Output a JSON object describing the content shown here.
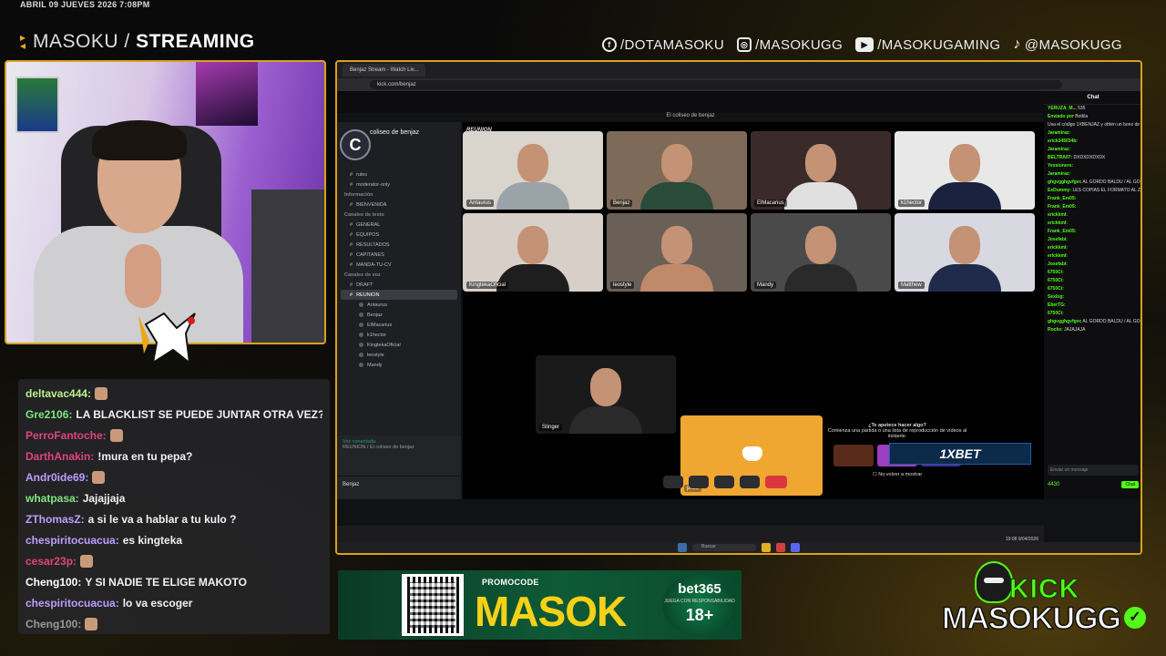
{
  "overlay": {
    "datetime": "ABRIL 09 JUEVES 2026 7:08PM",
    "brand_light": "MASOKU /",
    "brand_bold": "STREAMING",
    "socials": [
      {
        "icon": "facebook-icon",
        "label": "/DOTAMASOKU"
      },
      {
        "icon": "instagram-icon",
        "label": "/MASOKUGG"
      },
      {
        "icon": "youtube-icon",
        "label": "/MASOKUGAMING"
      },
      {
        "icon": "tiktok-icon",
        "label": "@MASOKUGG"
      }
    ],
    "accent": "#d9a21b"
  },
  "chat": {
    "messages": [
      {
        "user": "deltavac444:",
        "color": "#b9f18a",
        "text": "",
        "emote": true
      },
      {
        "user": "Gre2106:",
        "color": "#7ee87e",
        "text": "LA BLACKLIST SE PUEDE JUNTAR OTRA VEZ?",
        "emote": false
      },
      {
        "user": "PerroFantoche:",
        "color": "#e0457b",
        "text": "",
        "emote": true
      },
      {
        "user": "DarthAnakin:",
        "color": "#e0457b",
        "text": "!mura en tu pepa?",
        "emote": false
      },
      {
        "user": "Andr0ide69:",
        "color": "#b9a0ff",
        "text": "",
        "emote": true
      },
      {
        "user": "whatpasa:",
        "color": "#7ee87e",
        "text": "Jajajjaja",
        "emote": false
      },
      {
        "user": "ZThomasZ:",
        "color": "#b9a0ff",
        "text": "a si le va a hablar a tu kulo ?",
        "emote": false
      },
      {
        "user": "chespiritocuacua:",
        "color": "#b9a0ff",
        "text": "es kingteka",
        "emote": false
      },
      {
        "user": "cesar23p:",
        "color": "#e0457b",
        "text": "",
        "emote": true
      },
      {
        "user": "Cheng100:",
        "color": "#ffffff",
        "text": "Y SI NADIE TE ELIGE MAKOTO",
        "emote": false
      },
      {
        "user": "chespiritocuacua:",
        "color": "#b9a0ff",
        "text": "lo va escoger",
        "emote": false
      },
      {
        "user": "Cheng100:",
        "color": "#9a9a9a",
        "text": "",
        "emote": true
      }
    ]
  },
  "browser": {
    "tab": "Benjaz Stream - Watch Liv...",
    "url": "kick.com/benjaz"
  },
  "discord": {
    "window_title": "El coliseo de benjaz",
    "server_name": "coliseo de benjaz",
    "sidebar": [
      {
        "label": "rules",
        "type": "ch"
      },
      {
        "label": "moderator-only",
        "type": "ch"
      },
      {
        "label": "Información",
        "type": "head"
      },
      {
        "label": "BIENVENIDA",
        "type": "ch"
      },
      {
        "label": "Canales de texto",
        "type": "head"
      },
      {
        "label": "GENERAL",
        "type": "ch"
      },
      {
        "label": "EQUIPOS",
        "type": "ch"
      },
      {
        "label": "RESULTADOS",
        "type": "ch"
      },
      {
        "label": "CAPITANES",
        "type": "ch"
      },
      {
        "label": "MANDA-TU-CV",
        "type": "ch"
      },
      {
        "label": "Canales de voz",
        "type": "head"
      },
      {
        "label": "DRAFT",
        "type": "ch"
      },
      {
        "label": "REUNION",
        "type": "sel"
      },
      {
        "label": "Antaurus",
        "type": "user"
      },
      {
        "label": "Benjaz",
        "type": "user"
      },
      {
        "label": "ElMacarius",
        "type": "user"
      },
      {
        "label": "k1hector",
        "type": "user"
      },
      {
        "label": "KingtekaOficial",
        "type": "user"
      },
      {
        "label": "leostyle",
        "type": "user"
      },
      {
        "label": "Mandy",
        "type": "user"
      }
    ],
    "voice_status": "Voz conectada",
    "voice_channel": "REUNION / El coliseo de benjaz",
    "user_name": "Benjaz",
    "stage_title": "REUNION",
    "tiles": [
      {
        "name": "Antaurus",
        "bg": "#d9d4cc",
        "shirt": "#9aa3a8"
      },
      {
        "name": "Benjaz",
        "bg": "#7d6a58",
        "shirt": "#2a4a3a"
      },
      {
        "name": "ElMacarius",
        "bg": "#3a2a2a",
        "shirt": "#e0e0e0"
      },
      {
        "name": "k1hector",
        "bg": "#e8e8e8",
        "shirt": "#1a2240"
      },
      {
        "name": "KingtekaOficial",
        "bg": "#d8d0c8",
        "shirt": "#1e1e1e"
      },
      {
        "name": "leostyle",
        "bg": "#6a6058",
        "shirt": "#c08a6a"
      },
      {
        "name": "Mandy",
        "bg": "#4a4a4a",
        "shirt": "#2a2a2a"
      },
      {
        "name": "Matthew",
        "bg": "#d8d8e0",
        "shirt": "#202a4a"
      },
      {
        "name": "Stinger",
        "bg": "#1a1a1a",
        "shirt": "#2a2a2a"
      }
    ],
    "pkza_label": "pkza",
    "activity_title": "¿Te apetece hacer algo?",
    "activity_sub": "Comienza una partida o una lista de reproducción de vídeos al instante.",
    "activity_checkbox": "No volver a mostrar",
    "sponsor": "1XBET"
  },
  "kick_chat": {
    "title": "Chat",
    "lines": [
      {
        "n": "YERUZA_M...",
        "t": "535"
      },
      {
        "n": "Enviado por",
        "t": "Botkla"
      },
      {
        "n": "",
        "t": "Usa el código 1XBENJAZ y obtén un bono de hasta s/1100 con tu primer..."
      },
      {
        "n": "Jaramiraz:",
        "t": ""
      },
      {
        "n": "erick345034b:",
        "t": ""
      },
      {
        "n": "Jaramiraz:",
        "t": ""
      },
      {
        "n": "BELTRA07:",
        "t": "DXDXDXDXDX"
      },
      {
        "n": "Yessioners:",
        "t": ""
      },
      {
        "n": "Jaramiraz:",
        "t": ""
      },
      {
        "n": "ghgvgghgvfgvc",
        "t": "AL GORDO BALDU / AL GORDO BALDU / DV"
      },
      {
        "n": "EsDummy:",
        "t": "LES COPIAS EL FORMATO AL ZZZ"
      },
      {
        "n": "Frank_Em05:",
        "t": ""
      },
      {
        "n": "Frank_Em05:",
        "t": ""
      },
      {
        "n": "erickkml:",
        "t": ""
      },
      {
        "n": "erickkml:",
        "t": ""
      },
      {
        "n": "Frank_Em05:",
        "t": ""
      },
      {
        "n": "Josefabi:",
        "t": ""
      },
      {
        "n": "erickkml:",
        "t": ""
      },
      {
        "n": "erickkml:",
        "t": ""
      },
      {
        "n": "Josefabi:",
        "t": ""
      },
      {
        "n": "6750Ci:",
        "t": ""
      },
      {
        "n": "6750Ci:",
        "t": ""
      },
      {
        "n": "6750Ci:",
        "t": ""
      },
      {
        "n": "Sexlog:",
        "t": ""
      },
      {
        "n": "EberTG:",
        "t": ""
      },
      {
        "n": "6750Ci:",
        "t": ""
      },
      {
        "n": "ghgvgghgvfgvc",
        "t": "AL GORDO BALDU / AL GORDO BALDU / VO"
      },
      {
        "n": "Rocks:",
        "t": "JAJAJAJA"
      }
    ],
    "input_placeholder": "Enviar un mensaje",
    "points": "4430",
    "chat_button": "Chat"
  },
  "taskbar": {
    "search": "Buscar",
    "time": "19:08",
    "date": "9/04/2026"
  },
  "promo": {
    "code_label": "PROMOCODE",
    "code": "MASOK",
    "brand": "bet365",
    "responsible": "JUEGA CON RESPONSABILIDAD",
    "age": "18+"
  },
  "kick_logo": {
    "kick": "KICK",
    "name": "MASOKUGG"
  }
}
